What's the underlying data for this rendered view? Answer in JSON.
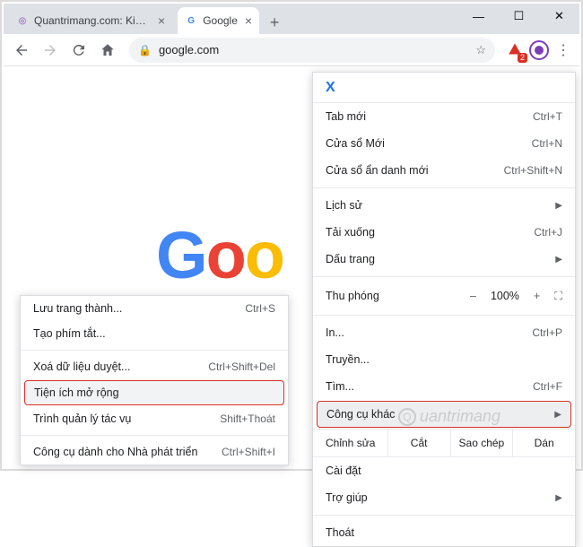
{
  "window": {
    "minimize": "—",
    "maximize": "☐",
    "close": "✕"
  },
  "tabs": [
    {
      "title": "Quantrimang.com: Kiến Thức...",
      "favicon_color": "#7b3fb5",
      "favicon_char": "◎",
      "active": false
    },
    {
      "title": "Google",
      "favicon_color": "#4285F4",
      "favicon_char": "G",
      "active": true
    }
  ],
  "newtab_label": "+",
  "toolbar": {
    "url": "google.com",
    "ext_badge": "2"
  },
  "logo": {
    "g1": "G",
    "o1": "o",
    "o2": "o"
  },
  "menu": {
    "x_icon": "X",
    "new_tab": "Tab mới",
    "new_tab_sc": "Ctrl+T",
    "new_window": "Cửa sổ Mới",
    "new_window_sc": "Ctrl+N",
    "incognito": "Cửa sổ ẩn danh mới",
    "incognito_sc": "Ctrl+Shift+N",
    "history": "Lịch sử",
    "downloads": "Tải xuống",
    "downloads_sc": "Ctrl+J",
    "bookmarks": "Dấu trang",
    "zoom_label": "Thu phóng",
    "zoom_minus": "–",
    "zoom_pct": "100%",
    "zoom_plus": "+",
    "zoom_full": "⛶",
    "print": "In...",
    "print_sc": "Ctrl+P",
    "cast": "Truyền...",
    "find": "Tìm...",
    "find_sc": "Ctrl+F",
    "more_tools": "Công cụ khác",
    "edit_label": "Chỉnh sửa",
    "cut": "Cắt",
    "copy": "Sao chép",
    "paste": "Dán",
    "settings": "Cài đặt",
    "help": "Trợ giúp",
    "exit": "Thoát"
  },
  "submenu": {
    "save_page": "Lưu trang thành...",
    "save_page_sc": "Ctrl+S",
    "create_shortcut": "Tạo phím tắt...",
    "clear_data": "Xoá dữ liệu duyệt...",
    "clear_data_sc": "Ctrl+Shift+Del",
    "extensions": "Tiện ích mở rộng",
    "task_manager": "Trình quản lý tác vụ",
    "task_manager_sc": "Shift+Thoát",
    "dev_tools": "Công cụ dành cho Nhà phát triển",
    "dev_tools_sc": "Ctrl+Shift+I"
  },
  "watermark": "uantrimang"
}
